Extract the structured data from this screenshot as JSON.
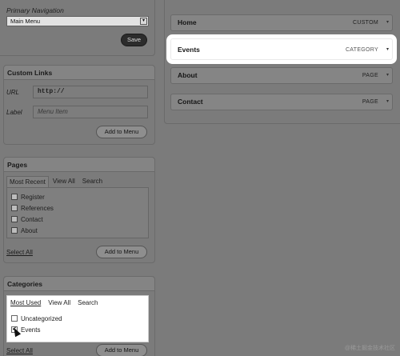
{
  "primary_nav": {
    "title": "Primary Navigation",
    "select_value": "Main Menu",
    "save_label": "Save"
  },
  "custom_links": {
    "title": "Custom Links",
    "url_label": "URL",
    "url_value": "http://",
    "label_label": "Label",
    "label_placeholder": "Menu Item",
    "add_label": "Add to Menu"
  },
  "pages": {
    "title": "Pages",
    "tabs": [
      "Most Recent",
      "View All",
      "Search"
    ],
    "items": [
      "Register",
      "References",
      "Contact",
      "About"
    ],
    "select_all": "Select All",
    "add_label": "Add to Menu"
  },
  "categories": {
    "title": "Categories",
    "tabs": [
      "Most Used",
      "View All",
      "Search"
    ],
    "items": [
      {
        "label": "Uncategorized",
        "checked": false
      },
      {
        "label": "Events",
        "checked": true
      }
    ],
    "select_all": "Select All",
    "add_label": "Add to Menu"
  },
  "menu": {
    "items": [
      {
        "label": "Home",
        "type": "CUSTOM"
      },
      {
        "label": "Events",
        "type": "CATEGORY"
      },
      {
        "label": "About",
        "type": "PAGE"
      },
      {
        "label": "Contact",
        "type": "PAGE"
      }
    ]
  },
  "watermark": "@稀土掘金技术社区"
}
